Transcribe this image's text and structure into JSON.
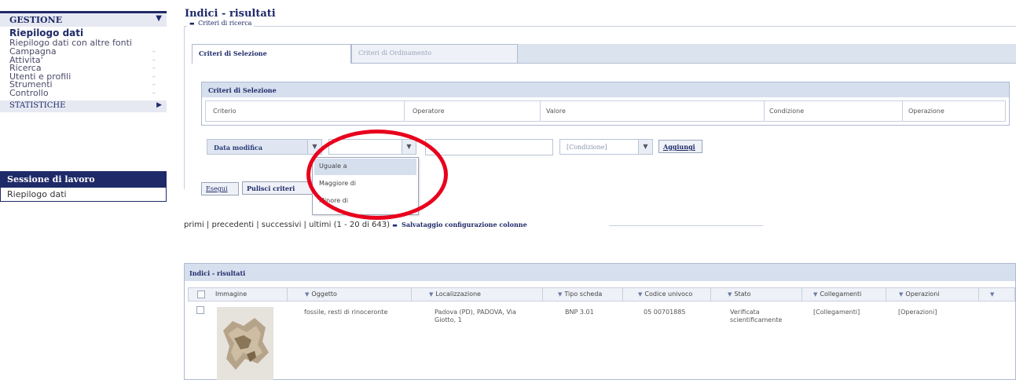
{
  "sidebar": {
    "section_title": "GESTIONE",
    "section_arrow": "▼",
    "items": [
      {
        "label": "Riepilogo dati",
        "active": true
      },
      {
        "label": "Riepilogo dati con altre fonti",
        "active": false
      },
      {
        "label": "Campagna",
        "active": false
      },
      {
        "label": "Attivita'",
        "active": false
      },
      {
        "label": "Ricerca",
        "active": false
      },
      {
        "label": "Utenti e profili",
        "active": false
      },
      {
        "label": "Strumenti",
        "active": false
      },
      {
        "label": "Controllo",
        "active": false
      }
    ],
    "dash": "–",
    "stat_title": "STATISTICHE",
    "stat_arrow": "▶",
    "session_title": "Sessione di lavoro",
    "session_item": "Riepilogo dati"
  },
  "main": {
    "title": "Indici - risultati",
    "legend": "Criteri di ricerca",
    "legend_toggle": "▬",
    "tabs": [
      {
        "label": "Criteri di Selezione"
      },
      {
        "label": "Criteri di Ordinamento"
      }
    ],
    "criteria_panel_title": "Criteri di Selezione",
    "criteria_columns": [
      "Criterio",
      "Operatore",
      "Valore",
      "Condizione",
      "Operazione"
    ],
    "field_value": "Data modifica",
    "operator_value": "",
    "value_input": "",
    "condition_value": "[Condizione]",
    "combo_arrow": "▼",
    "add_button": "Aggiungi",
    "exec_button": "Esegui",
    "clear_button": "Pulisci criteri",
    "operator_options": [
      "Uguale a",
      "Maggiore di",
      "Minore di"
    ],
    "selected_option": "Uguale a"
  },
  "pager": {
    "text": "primi | precedenti | successivi | ultimi (1 - 20 di 643)",
    "save_toggle": "▬",
    "save_label": "Salvataggio configurazione colonne"
  },
  "results": {
    "title": "Indici - risultati",
    "sort_glyph": "▼",
    "columns": [
      "Immagine",
      "Oggetto",
      "Localizzazione",
      "Tipo scheda",
      "Codice univoco",
      "Stato",
      "Collegamenti",
      "Operazioni"
    ],
    "rows": [
      {
        "oggetto": "fossile, resti di rinoceronte",
        "localizzazione_1": "Padova (PD), PADOVA, Via",
        "localizzazione_2": "Giotto, 1",
        "tipo_scheda": "BNP 3.01",
        "codice": "05 00701885",
        "stato_1": "Verificata",
        "stato_2": "scientificamente",
        "collegamenti": "[Collegamenti]",
        "operazioni": "[Operazioni]"
      }
    ]
  },
  "colors": {
    "primary": "#1f2a68",
    "highlight": "#e8001c",
    "panel": "#d6dfed"
  }
}
